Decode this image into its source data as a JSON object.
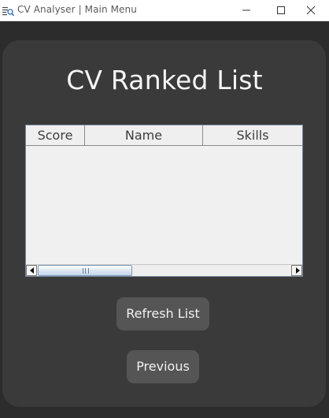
{
  "window": {
    "title": "CV Analyser | Main Menu",
    "app_icon": "document-magnifier-icon",
    "controls": [
      "minimize-icon",
      "maximize-icon",
      "close-icon"
    ]
  },
  "main": {
    "heading": "CV Ranked List"
  },
  "table": {
    "columns": [
      "Score",
      "Name",
      "Skills"
    ],
    "rows": []
  },
  "scrollbar": {
    "left_arrow": "arrow-left-icon",
    "right_arrow": "arrow-right-icon"
  },
  "buttons": {
    "refresh_label": "Refresh List",
    "previous_label": "Previous"
  },
  "colors": {
    "background": "#2c2c2c",
    "panel": "#3a3a3a",
    "button": "#555555",
    "text": "#f5f5f5",
    "table_bg": "#efefef"
  }
}
